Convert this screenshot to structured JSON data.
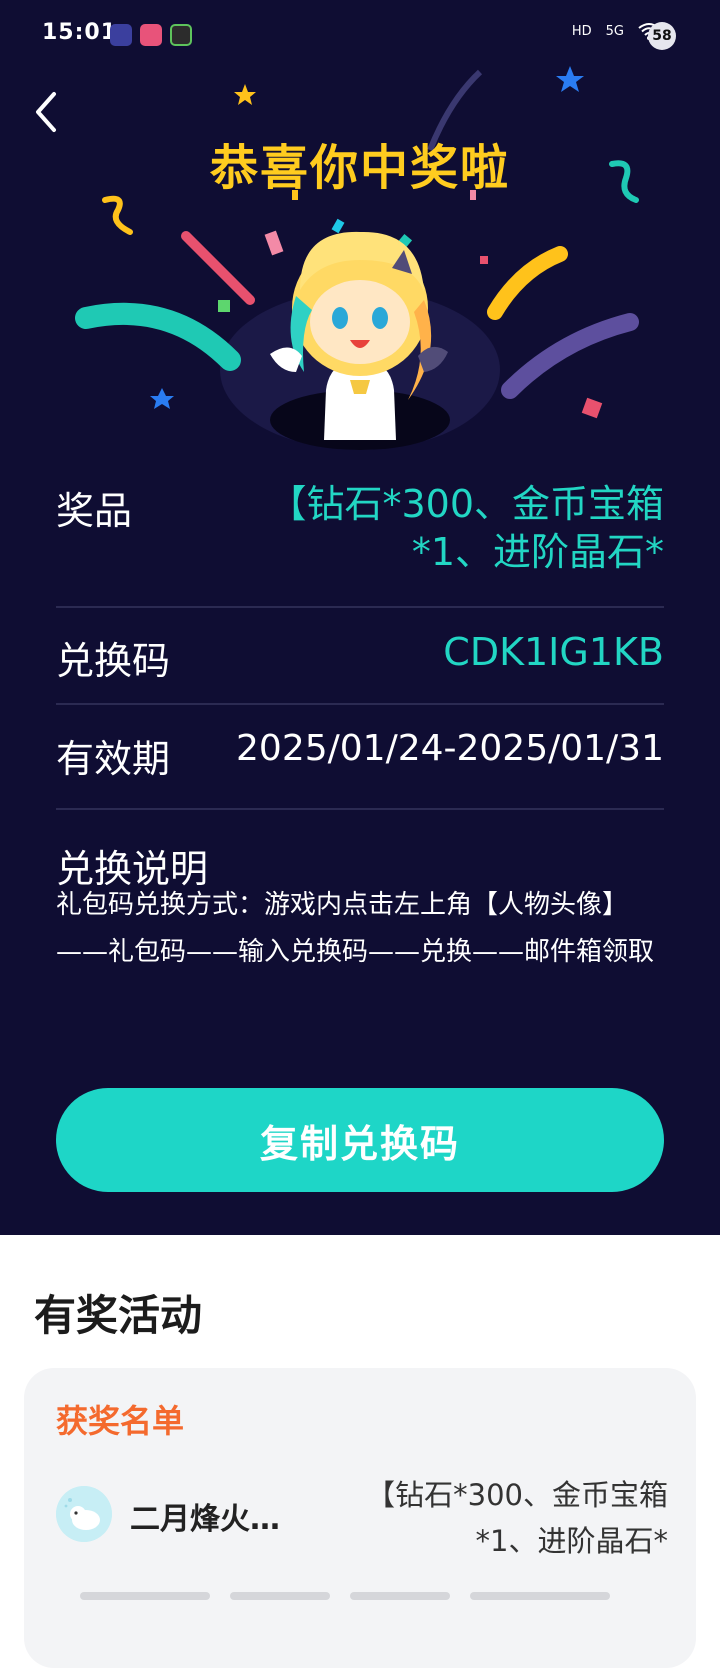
{
  "status_bar": {
    "time": "15:01",
    "battery": "58",
    "signal_text_1": "HD",
    "signal_text_2": "5G"
  },
  "header": {
    "headline": "恭喜你中奖啦"
  },
  "prize": {
    "label": "奖品",
    "value": "【钻石*300、金币宝箱*1、进阶晶石*"
  },
  "code": {
    "label": "兑换码",
    "value": "CDK1IG1KB"
  },
  "validity": {
    "label": "有效期",
    "value": "2025/01/24-2025/01/31"
  },
  "instructions": {
    "title": "兑换说明",
    "text": "礼包码兑换方式：游戏内点击左上角【人物头像】——礼包码——输入兑换码——兑换——邮件箱领取"
  },
  "copy_button": {
    "label": "复制兑换码"
  },
  "activity": {
    "section_title": "有奖活动",
    "card_title": "获奖名单",
    "winners": [
      {
        "name": "二月烽火…",
        "prize": "【钻石*300、金币宝箱*1、进阶晶石*"
      }
    ]
  },
  "colors": {
    "background_dark": "#0f0d33",
    "accent_teal": "#1ed6c7",
    "headline_yellow": "#ffcc1f",
    "card_title_orange": "#f46a2e"
  },
  "icons": {
    "back": "chevron-left-icon"
  }
}
